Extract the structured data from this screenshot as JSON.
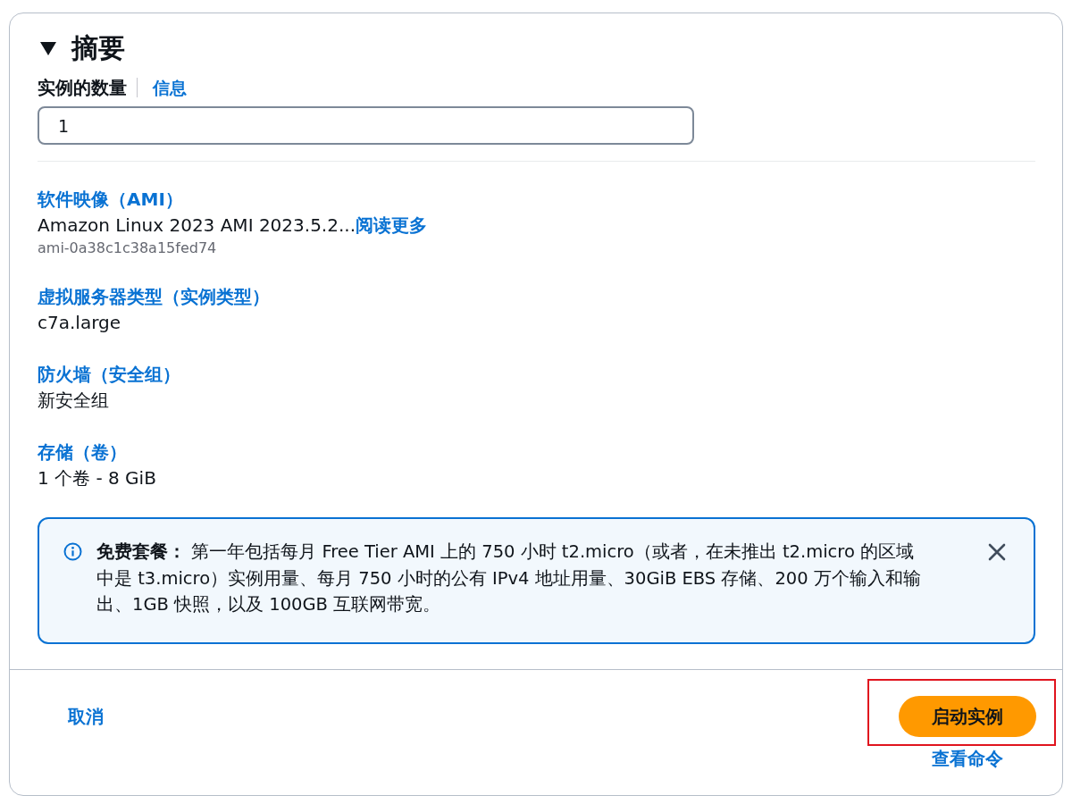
{
  "summary": {
    "title": "摘要",
    "expanded": true,
    "instance_count": {
      "label": "实例的数量",
      "info_link": "信息",
      "value": "1"
    },
    "details": [
      {
        "label": "软件映像（AMI）",
        "value": "Amazon Linux 2023 AMI 2023.5.2...",
        "link": "阅读更多",
        "sub": "ami-0a38c1c38a15fed74"
      },
      {
        "label": "虚拟服务器类型（实例类型）",
        "value": "c7a.large"
      },
      {
        "label": "防火墙（安全组）",
        "value": "新安全组"
      },
      {
        "label": "存储（卷）",
        "value": "1 个卷 - 8 GiB"
      }
    ],
    "alert": {
      "text": "**免费套餐：** 第一年包括每月 Free Tier AMI 上的 750 小时 t2.micro（或者，在未推出 t2.micro 的区域中是 t3.micro）实例用量、每月 750 小时的公有 IPv4 地址用量、30GiB EBS 存储、200 万个输入和输出、1GB 快照，以及 100GB 互联网带宽。"
    }
  },
  "footer": {
    "cancel": "取消",
    "launch_button": {
      "label": "启动实例",
      "highlighted": true
    },
    "view_commands": "查看命令"
  }
}
